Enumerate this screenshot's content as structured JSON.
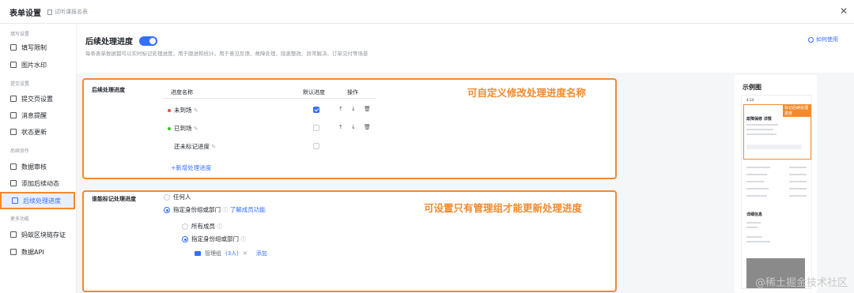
{
  "topbar": {
    "title": "表单设置",
    "subtitle": "试听课报名表",
    "close": "✕"
  },
  "sidebar": {
    "sections": [
      "填写设置",
      "提交设置",
      "后续协作",
      "更多功能"
    ],
    "items": [
      "填写限制",
      "图片水印",
      "提交页设置",
      "消息提醒",
      "状态更新",
      "数据审核",
      "添加后续动态",
      "后续处理进度",
      "蚂蚁区块链存证",
      "数据API"
    ]
  },
  "header": {
    "title": "后续处理进度",
    "desc": "每条表单数据都可以实时标记处理进度，用于跟进和统计。用于意见反馈、故障处理、隐患整改、异常解决、订单交付等场景",
    "help": "如何使用"
  },
  "progress": {
    "label": "后续处理进度",
    "columns": [
      "进度名称",
      "默认进度",
      "操作"
    ],
    "rows": [
      {
        "name": "未到场",
        "color": "#f54a45",
        "default": true
      },
      {
        "name": "已到场",
        "color": "#34c724",
        "default": false
      },
      {
        "name": "还未标记进度",
        "color": "",
        "default": false
      }
    ],
    "add": "+新增处理进度",
    "annotation": "可自定义修改处理进度名称"
  },
  "permission": {
    "label": "谁能标记处理进度",
    "opt1": "任何人",
    "opt2": "指定身份组或部门",
    "learn": "了解成员功能",
    "sub1": "所有成员",
    "sub2": "指定身份组或部门",
    "group": "管理组",
    "count": "(3人)",
    "add": "添加",
    "annotation": "可设置只有管理组才能更新处理进度"
  },
  "preview": {
    "title": "示例图",
    "time": "4:14",
    "badge": "标记后续处理进度",
    "card_title": "故障保修 详情",
    "detail": "详细信息"
  },
  "watermark": "@稀土掘金技术社区"
}
